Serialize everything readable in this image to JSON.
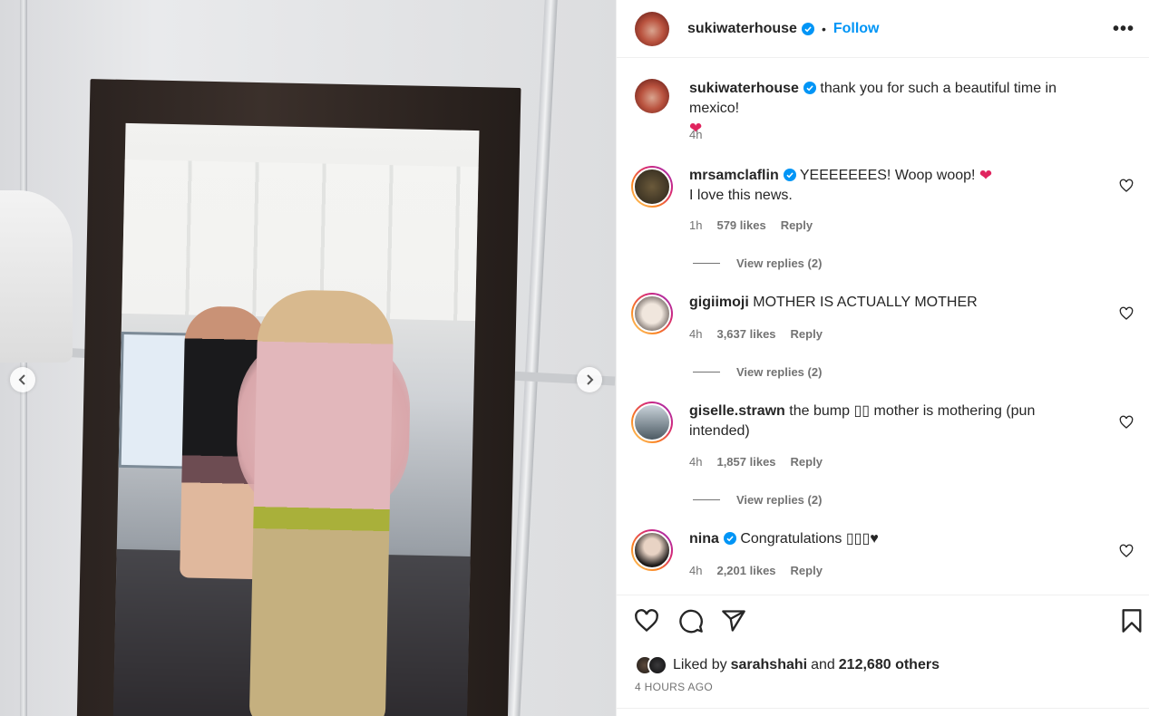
{
  "post": {
    "author": "sukiwaterhouse",
    "follow_label": "Follow",
    "separator": "•",
    "more_label": "•••"
  },
  "caption": {
    "username": "sukiwaterhouse",
    "text": "thank you for such a beautiful time in mexico!",
    "emoji": "❤",
    "time": "4h"
  },
  "comments": [
    {
      "username": "mrsamclaflin",
      "verified": true,
      "text": "YEEEEEEES! Woop woop!",
      "emoji": "❤",
      "text2": "I love this news.",
      "time": "1h",
      "likes": "579 likes",
      "reply_label": "Reply",
      "view_replies": "View replies (2)"
    },
    {
      "username": "gigiimoji",
      "verified": false,
      "text": "MOTHER IS ACTUALLY MOTHER",
      "time": "4h",
      "likes": "3,637 likes",
      "reply_label": "Reply",
      "view_replies": "View replies (2)"
    },
    {
      "username": "giselle.strawn",
      "verified": false,
      "text": "the bump ▯▯ mother is mothering (pun intended)",
      "time": "4h",
      "likes": "1,857 likes",
      "reply_label": "Reply",
      "view_replies": "View replies (2)"
    },
    {
      "username": "nina",
      "verified": true,
      "text": "Congratulations ▯▯▯♥",
      "time": "4h",
      "likes": "2,201 likes",
      "reply_label": "Reply"
    }
  ],
  "footer": {
    "liked_by_prefix": "Liked by",
    "liked_by_user": "sarahshahi",
    "liked_by_and": "and",
    "liked_by_others": "212,680 others",
    "time_ago": "4 HOURS AGO"
  },
  "icons": {
    "prev": "chevron-left-icon",
    "next": "chevron-right-icon",
    "like": "heart-icon",
    "comment": "comment-icon",
    "share": "share-icon",
    "save": "bookmark-icon",
    "verified": "verified-badge-icon"
  },
  "colors": {
    "accent": "#0095f6",
    "verified": "#0095f6",
    "text": "#262626",
    "secondary": "#737373",
    "heart": "#e0245e"
  }
}
